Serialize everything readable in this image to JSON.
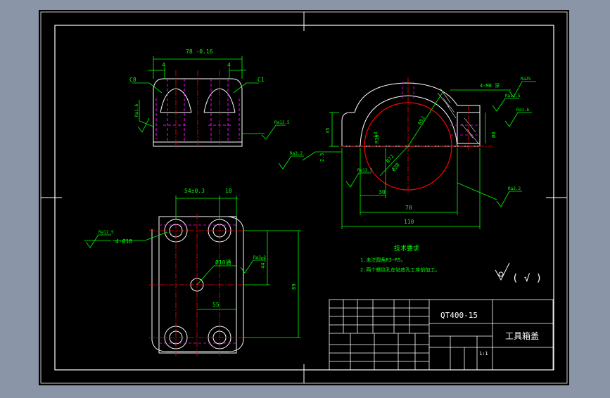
{
  "colors": {
    "background": "#8a96a8",
    "paper": "#000000",
    "line": "#ffffff",
    "dimension": "#00ff00",
    "hidden": "#ff00ff",
    "center": "#ff0000",
    "cyan": "#00ffff",
    "label": "#e0e000"
  },
  "title_block": {
    "material": "QT400-15",
    "part_name": "工具箱盖",
    "scale": "1:1"
  },
  "notes": {
    "heading": "技术要求",
    "line1": "1.未注圆角R3~R5。",
    "line2": "2.两个螺纹孔在钻底孔工序前加工。"
  },
  "top_view": {
    "dim_overall": "78 -0.16",
    "dim_left": "4",
    "dim_right": "4",
    "label_c8": "C8",
    "label_c1": "C1",
    "rough_left": "Ra1.6",
    "rough_right": "Ra12.5"
  },
  "plan_view": {
    "dim_pitch": "54±0.3",
    "dim_right": "18",
    "hole_callout": "4-Ø18",
    "rough_holes": "Ra12.5",
    "center_hole": "Ø10通",
    "rough_center": "Ra3.2",
    "dim_vertical": "44.5",
    "dim_overall_v": "89",
    "dim_bottom": "55"
  },
  "front_view": {
    "thread_callout": "4-M8 深",
    "rough_thread_1": "Ra25",
    "rough_thread_2": "Ra12.5",
    "rough_thread_3": "Ra1.6",
    "dim_thread_v": "Ø8",
    "dim_height": "35",
    "dim_small": "2.5",
    "dim_inner": "Ø72",
    "dim_r": "R52",
    "dim_r_small": "R36",
    "dim_bore": "Ø38",
    "dim_30": "30",
    "dim_70": "70",
    "dim_110": "110",
    "rough_base": "Ra3.2",
    "rough_bottom": "Ra12.5",
    "rough_left": "Ra3.2",
    "dim_13": "13"
  },
  "rough_symbol_other": "( √ )"
}
